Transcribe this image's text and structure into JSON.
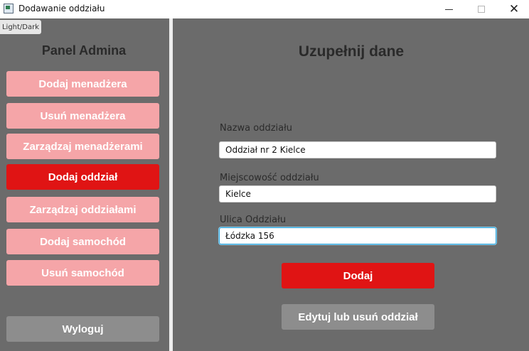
{
  "window": {
    "title": "Dodawanie oddziału",
    "minimize_glyph": "minimize-icon",
    "maximize_glyph": "maximize-icon",
    "close_symbol": "✕"
  },
  "theme_toggle": "Light/Dark",
  "sidebar": {
    "title": "Panel Admina",
    "items": [
      {
        "label": "Dodaj menadżera",
        "active": false
      },
      {
        "label": "Usuń menadżera",
        "active": false
      },
      {
        "label": "Zarządzaj menadżerami",
        "active": false
      },
      {
        "label": "Dodaj oddział",
        "active": true
      },
      {
        "label": "Zarządzaj oddziałami",
        "active": false
      },
      {
        "label": "Dodaj samochód",
        "active": false
      },
      {
        "label": "Usuń samochód",
        "active": false
      }
    ],
    "logout_label": "Wyloguj"
  },
  "main": {
    "title": "Uzupełnij dane",
    "fields": [
      {
        "label": "Nazwa oddziału",
        "value": "Oddział nr 2 Kielce"
      },
      {
        "label": "Miejscowość oddziału",
        "value": "Kielce"
      },
      {
        "label": "Ulica Oddziału",
        "value": "Łódzka 156"
      }
    ],
    "submit_label": "Dodaj",
    "edit_label": "Edytuj lub usuń oddział"
  },
  "colors": {
    "accent": "#e01414",
    "nav_inactive": "#f5a5a8",
    "background": "#6b6b6b",
    "secondary_button": "#8d8d8d"
  }
}
